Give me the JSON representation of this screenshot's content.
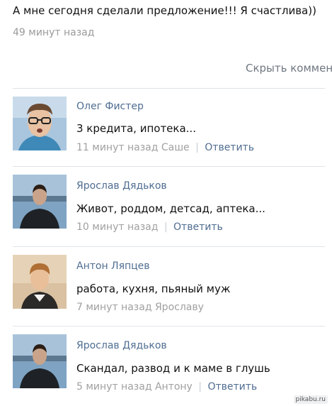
{
  "post": {
    "text": "А мне сегодня сделали предложение!!! Я счастлива))",
    "time": "49 минут назад"
  },
  "hide_comments_label": "Скрыть коммент",
  "comments": [
    {
      "author": "Олег Фистер",
      "text": "3 кредита, ипотека...",
      "time": "11 минут назад",
      "reply_to": "Саше",
      "reply_label": "Ответить"
    },
    {
      "author": "Ярослав Дядьков",
      "text": "Живот, роддом, детсад, аптека...",
      "time": "10 минут назад",
      "reply_to": "",
      "reply_label": "Ответить"
    },
    {
      "author": "Антон Ляпцев",
      "text": "работа, кухня, пьяный муж",
      "time": "7 минут назад",
      "reply_to": "Ярославу",
      "reply_label": ""
    },
    {
      "author": "Ярослав Дядьков",
      "text": "Скандал, развод и к маме в глушь",
      "time": "5 минут назад",
      "reply_to": "Антону",
      "reply_label": "Ответить"
    }
  ],
  "watermark": "pikabu.ru"
}
